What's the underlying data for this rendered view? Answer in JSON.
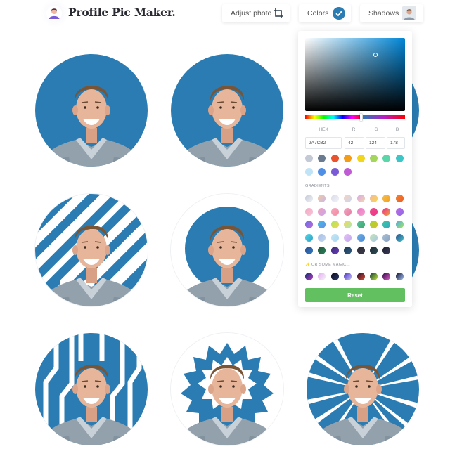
{
  "header": {
    "brand": "Profile Pic Maker.",
    "adjust_label": "Adjust photo",
    "colors_label": "Colors",
    "shadows_label": "Shadows"
  },
  "colors": {
    "brand_blue": "#2A7CB2",
    "reset_green": "#62C060"
  },
  "avatars": [
    {
      "style": "solid"
    },
    {
      "style": "solid"
    },
    {
      "style": "solid"
    },
    {
      "style": "diagonal-stripes"
    },
    {
      "style": "inner-circle"
    },
    {
      "style": "solid"
    },
    {
      "style": "vertical-stripes"
    },
    {
      "style": "star-burst"
    },
    {
      "style": "sun-rays"
    }
  ],
  "picker": {
    "hex_label": "HEX",
    "r_label": "R",
    "g_label": "G",
    "b_label": "B",
    "hex_value": "2A7CB2",
    "r_value": "42",
    "g_value": "124",
    "b_value": "178",
    "gradients_label": "GRADIENTS",
    "magic_label": "OR SOME MAGIC...",
    "reset_label": "Reset",
    "solid_swatches": [
      "#c4c9d6",
      "#6a7a8f",
      "#e8542e",
      "#f39c1a",
      "#f1d61e",
      "#a4d65e",
      "#5bd6a8",
      "#3ec6c6",
      "#bfe3f7",
      "#4f8fe6",
      "#7a5bd6",
      "#c05bd6"
    ],
    "gradient_swatches": [
      [
        "#c4c9d6",
        "#eef1f5"
      ],
      [
        "#f5c9a0",
        "#c4b8e8"
      ],
      [
        "#d8dbe8",
        "#f3f3f8"
      ],
      [
        "#f7d3c0",
        "#c9d6f0"
      ],
      [
        "#d8a8e6",
        "#f5d6a8"
      ],
      [
        "#f5b8a0",
        "#f5d64f"
      ],
      [
        "#f5c04f",
        "#f59e1e"
      ],
      [
        "#f5852e",
        "#e85c2e"
      ],
      [
        "#f5a8c4",
        "#f5c4d6"
      ],
      [
        "#f0a0b8",
        "#c8a8f0"
      ],
      [
        "#f5a8c0",
        "#f58aa0"
      ],
      [
        "#f0a8c0",
        "#e87aa0"
      ],
      [
        "#e87ac4",
        "#f59ed0"
      ],
      [
        "#e8508a",
        "#f5308a"
      ],
      [
        "#f0308a",
        "#e8a83a"
      ],
      [
        "#c06ae6",
        "#8a6ae6"
      ],
      [
        "#6a6ae6",
        "#c06ad6"
      ],
      [
        "#3ec0e8",
        "#6a8ae6"
      ],
      [
        "#a8e65e",
        "#f5d64f"
      ],
      [
        "#f5d64f",
        "#a8e8c0"
      ],
      [
        "#5bc0a0",
        "#3ea86a"
      ],
      [
        "#a4d62e",
        "#d6c02e"
      ],
      [
        "#3ec6a0",
        "#2ea8c6"
      ],
      [
        "#4fa8e6",
        "#a4e65e"
      ],
      [
        "#4fd6e6",
        "#2ea0c6"
      ],
      [
        "#a8c0e6",
        "#c4d6f0"
      ],
      [
        "#c4e6f5",
        "#a8d6f0"
      ],
      [
        "#e6c0f5",
        "#c0a8f0"
      ],
      [
        "#6ab0e6",
        "#4f8ad6"
      ],
      [
        "#c6e6b8",
        "#a8c6e6"
      ],
      [
        "#a8c0d6",
        "#8aa0c0"
      ],
      [
        "#2e4e8a",
        "#3ec0c6"
      ],
      [
        "#2e4e8a",
        "#2e7ac6"
      ],
      [
        "#1e5a3a",
        "#2e7a5a"
      ],
      [
        "#3a2e6a",
        "#6a3ac6"
      ],
      [
        "#1e3a5a",
        "#2e5a7a"
      ],
      [
        "#2e2e3a",
        "#3a3a4a"
      ],
      [
        "#1e2e3a",
        "#2e4a4e"
      ],
      [
        "#1e1e2e",
        "#3a3a5a"
      ]
    ],
    "magic_swatches": [
      [
        "#0a2e6a",
        "#c03ac6"
      ],
      [
        "#e6a8f5",
        "#f5f5f5"
      ],
      [
        "#0a0a1e",
        "#2e3a6a"
      ],
      [
        "#4a2ec6",
        "#c6c6f5"
      ],
      [
        "#1e0a2e",
        "#e64f2e"
      ],
      [
        "#0a3a2e",
        "#c6e63e"
      ],
      [
        "#2e0a4a",
        "#e65ec6"
      ],
      [
        "#0a0a2e",
        "#a8c6f5"
      ]
    ]
  }
}
